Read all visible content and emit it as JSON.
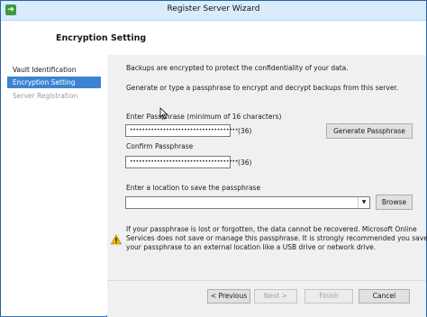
{
  "window": {
    "title": "Register Server Wizard"
  },
  "header": {
    "title": "Encryption Setting"
  },
  "sidebar": {
    "items": [
      {
        "label": "Vault Identification",
        "state": "normal"
      },
      {
        "label": "Encryption Setting",
        "state": "active"
      },
      {
        "label": "Server Registration",
        "state": "disabled"
      }
    ]
  },
  "main": {
    "intro1": "Backups are encrypted to protect the confidentiality of your data.",
    "intro2": "Generate or type a passphrase to encrypt and decrypt backups from this server.",
    "passphrase_label": "Enter Passphrase (minimum of 16 characters)",
    "passphrase_mask": "••••••••••••••••••••••••••••••••••••",
    "passphrase_count": "(36)",
    "generate_label": "Generate Passphrase",
    "confirm_label": "Confirm Passphrase",
    "confirm_mask": "••••••••••••••••••••••••••••••••••••",
    "confirm_count": "(36)",
    "location_label": "Enter a location to save the passphrase",
    "location_value": "",
    "browse_label": "Browse",
    "warning_line1": "If your passphrase is lost or forgotten, the data cannot be recovered. Microsoft Online",
    "warning_line2": "Services does not save or manage this passphrase. It is strongly recommended you save",
    "warning_line3": "your passphrase to an external location like a USB drive or network drive."
  },
  "footer": {
    "previous_label": "< Previous",
    "next_label": "Next >",
    "finish_label": "Finish",
    "cancel_label": "Cancel"
  },
  "colors": {
    "accent": "#3c84d2",
    "titlebar": "#d9ecfb",
    "panel": "#f0f0f0",
    "warning": "#f2c200"
  },
  "icons": {
    "app": "arrow-right-icon",
    "warning": "warning-icon",
    "dropdown": "chevron-down-icon"
  }
}
